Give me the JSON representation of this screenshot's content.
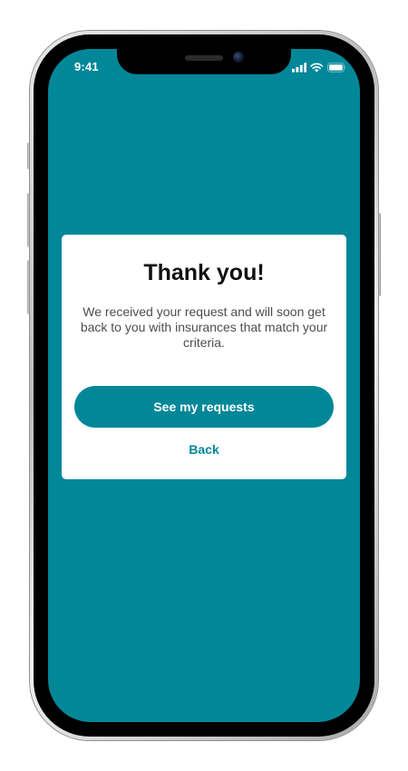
{
  "status_bar": {
    "time": "9:41",
    "icons": [
      "cellular-signal-icon",
      "wifi-icon",
      "battery-icon"
    ]
  },
  "dialog": {
    "title": "Thank you!",
    "message": "We received your request and will soon get back to you with insurances that match your criteria.",
    "primary_button": "See my requests",
    "secondary_link": "Back"
  },
  "colors": {
    "accent": "#028799",
    "card_background": "#ffffff",
    "title_text": "#111111",
    "body_text": "#4d4d4d"
  }
}
